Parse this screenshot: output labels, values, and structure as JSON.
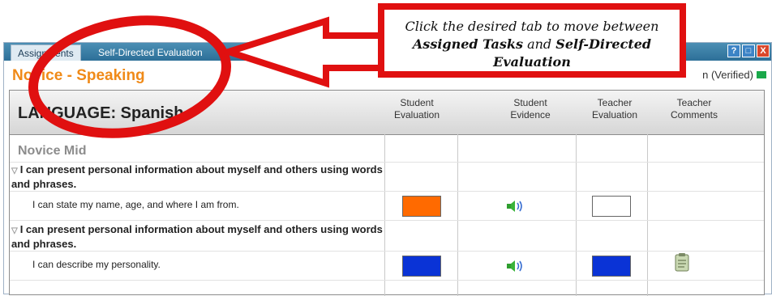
{
  "tabs": [
    {
      "label": "Assignments"
    },
    {
      "label": "Self-Directed Evaluation"
    }
  ],
  "window_buttons": {
    "help": "?",
    "max": "□",
    "close": "X"
  },
  "header": {
    "title": "Novice - Speaking",
    "status": "n (Verified)"
  },
  "table": {
    "language_title": "LANGUAGE: Spanish",
    "columns": [
      "Student\nEvaluation",
      "Student\nEvidence",
      "Teacher\nEvaluation",
      "Teacher\nComments"
    ],
    "level": "Novice Mid",
    "rows": [
      {
        "statement": "I can present personal information about myself and others using words and phrases.",
        "can_do": "I can state my name, age, and where I am from.",
        "student_eval_color": "#ff6a00",
        "teacher_eval_color": "#ffffff"
      },
      {
        "statement": "I can present personal information about myself and others using words and phrases.",
        "can_do": "I can describe my personality.",
        "student_eval_color": "#0a33d6",
        "teacher_eval_color": "#0a33d6"
      }
    ]
  },
  "annotation": {
    "text_prefix": "Click the desired tab to move between ",
    "bold1": "Assigned Tasks",
    "text_mid": " and ",
    "bold2": "Self-Directed Evaluation",
    "color": "#e01010"
  },
  "icons": [
    "speaker-icon",
    "clipboard-icon",
    "triangle-expand-icon"
  ]
}
